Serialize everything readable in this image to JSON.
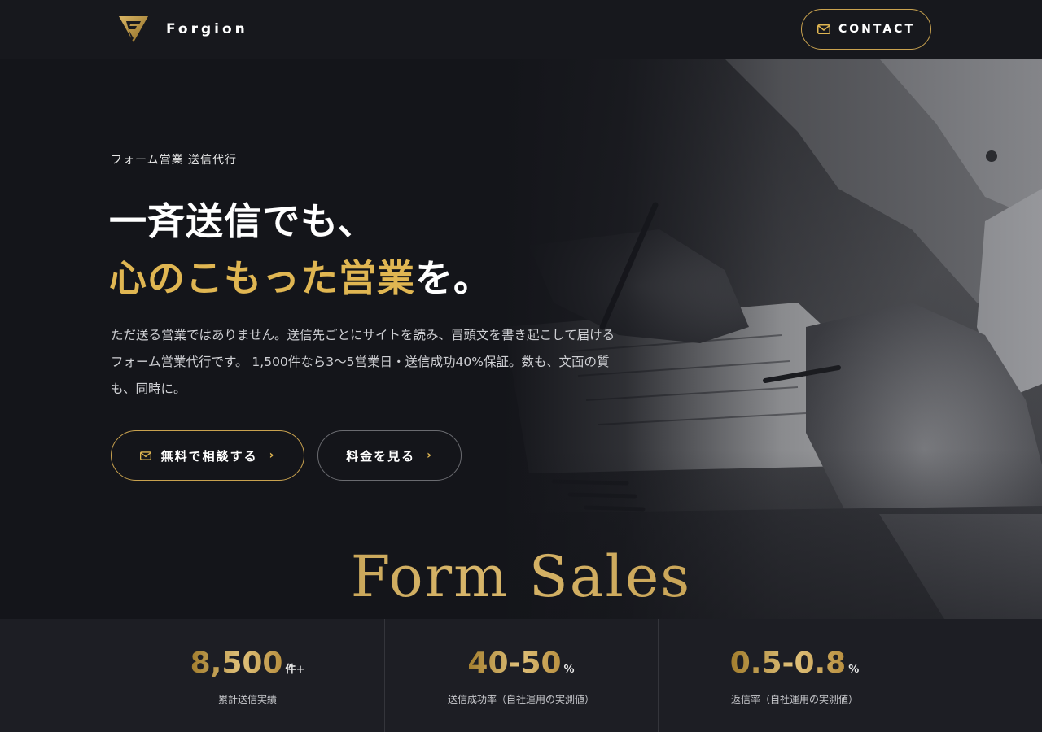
{
  "header": {
    "brand_name": "Forgion",
    "contact_label": "CONTACT"
  },
  "hero": {
    "eyebrow": "フォーム営業 送信代行",
    "headline_line1": "一斉送信でも、",
    "headline_line2_gold": "心のこもった営業",
    "headline_line2_white": "を。",
    "lead": "ただ送る営業ではありません。送信先ごとにサイトを読み、冒頭文を書き起こして届けるフォーム営業代行です。 1,500件なら3〜5営業日・送信成功40%保証。数も、文面の質も、同時に。",
    "primary_button_label": "無料で相談する",
    "secondary_button_label": "料金を見る",
    "watermark": "Form Sales",
    "photo_icon": "business-handshake-photo"
  },
  "stats": [
    {
      "value": "8,500",
      "unit": "件+",
      "label": "累計送信実績"
    },
    {
      "value": "40-50",
      "unit": "%",
      "label": "送信成功率（自社運用の実測値）"
    },
    {
      "value": "0.5-0.8",
      "unit": "%",
      "label": "返信率（自社運用の実測値）"
    }
  ],
  "colors": {
    "accent_gold": "#e0b652",
    "background": "#14151a",
    "stats_background": "#1d1e24"
  }
}
